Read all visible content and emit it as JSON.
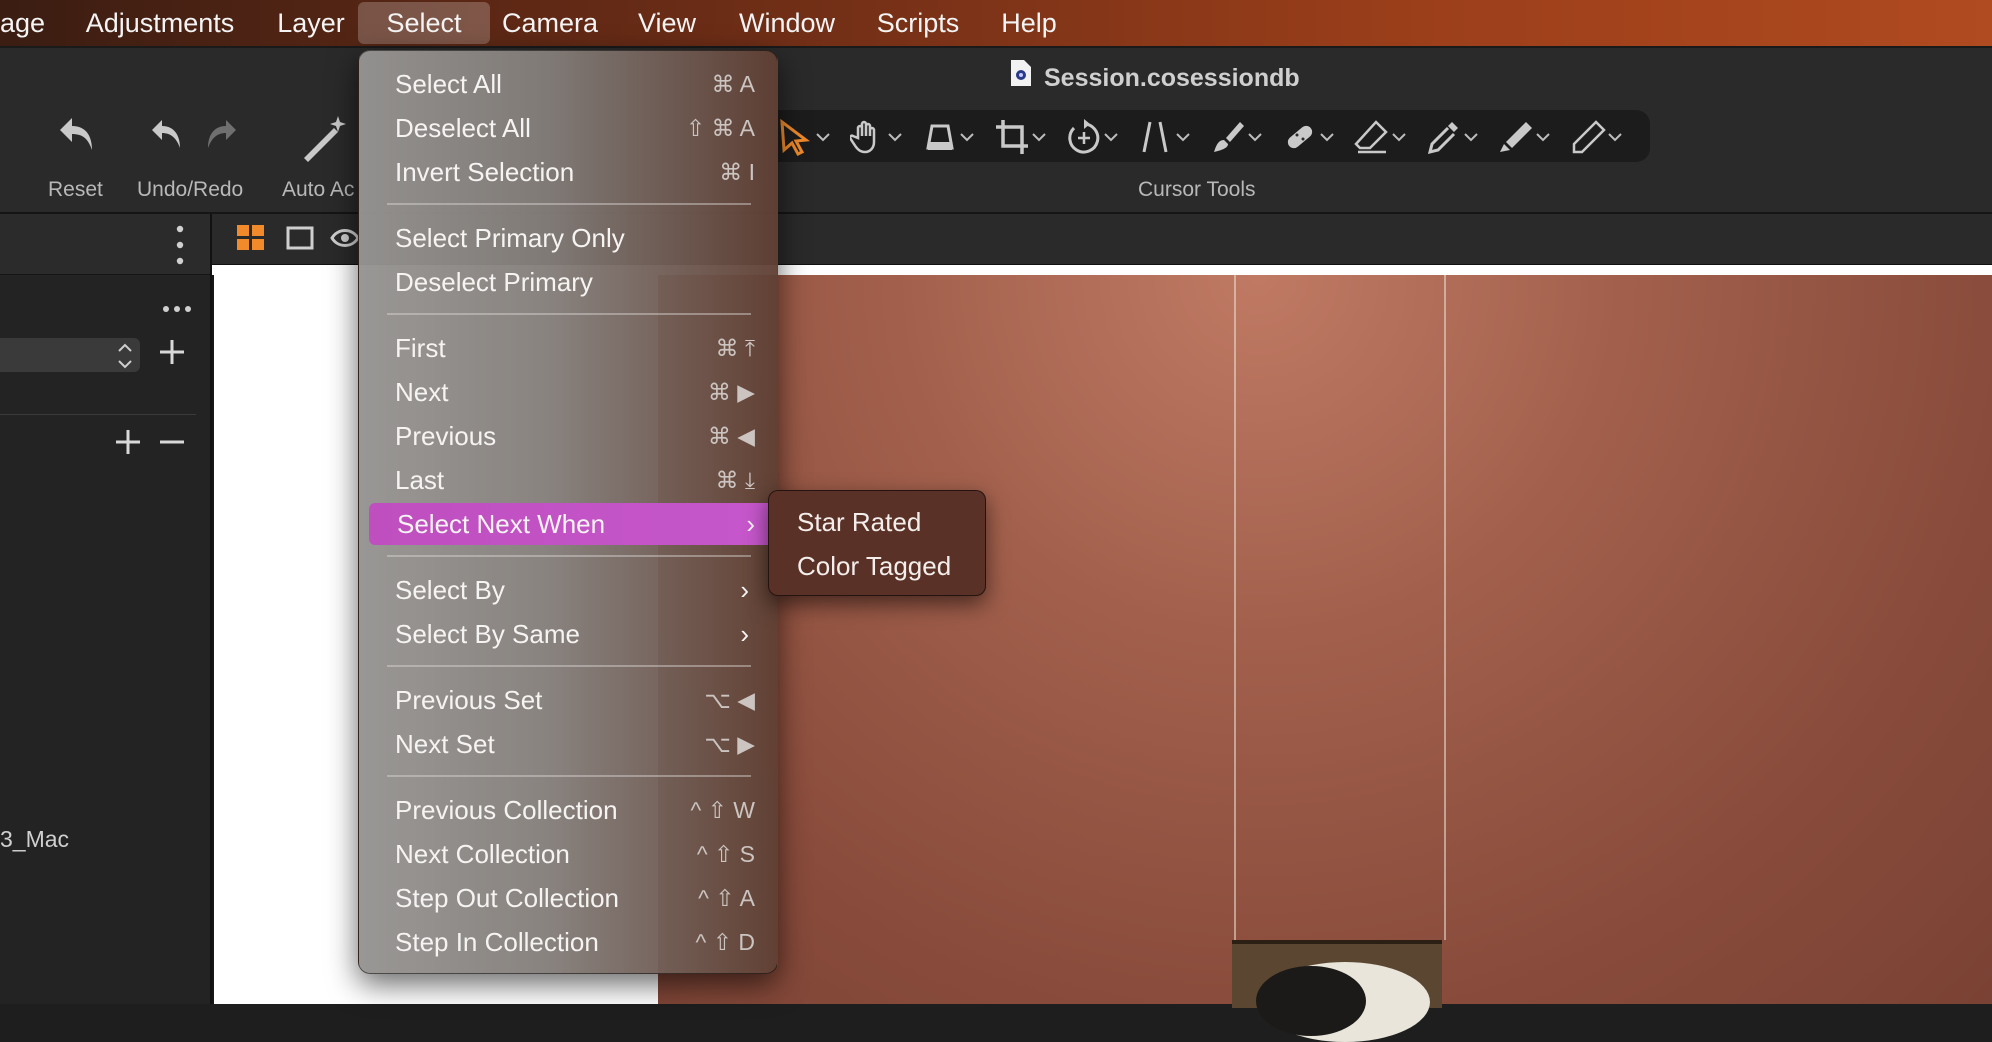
{
  "menubar": {
    "items": [
      {
        "label": "age"
      },
      {
        "label": "Adjustments"
      },
      {
        "label": "Layer"
      },
      {
        "label": "Select"
      },
      {
        "label": "Camera"
      },
      {
        "label": "View"
      },
      {
        "label": "Window"
      },
      {
        "label": "Scripts"
      },
      {
        "label": "Help"
      }
    ],
    "active": "Select"
  },
  "window": {
    "title": "Session.cosessiondb"
  },
  "toolbar": {
    "reset_label": "Reset",
    "undo_redo_label": "Undo/Redo",
    "auto_adjust_label": "Auto Ac",
    "cursor_tools_label": "Cursor Tools",
    "accent_color": "#f08a2a"
  },
  "left_panel": {
    "more_icon": "ellipsis-icon",
    "library_item": "3_Mac"
  },
  "select_menu": {
    "items": [
      {
        "label": "Select All",
        "shortcut": "⌘ A"
      },
      {
        "label": "Deselect All",
        "shortcut": "⇧ ⌘ A"
      },
      {
        "label": "Invert Selection",
        "shortcut": "⌘ I"
      },
      {
        "label": "Select Primary Only",
        "shortcut": ""
      },
      {
        "label": "Deselect Primary",
        "shortcut": ""
      },
      {
        "label": "First",
        "shortcut": "⌘ ⤒"
      },
      {
        "label": "Next",
        "shortcut": "⌘ ▶"
      },
      {
        "label": "Previous",
        "shortcut": "⌘ ◀"
      },
      {
        "label": "Last",
        "shortcut": "⌘ ⤓"
      },
      {
        "label": "Select Next When",
        "shortcut": ""
      },
      {
        "label": "Select By",
        "shortcut": ""
      },
      {
        "label": "Select By Same",
        "shortcut": ""
      },
      {
        "label": "Previous Set",
        "shortcut": "⌥ ◀"
      },
      {
        "label": "Next Set",
        "shortcut": "⌥ ▶"
      },
      {
        "label": "Previous Collection",
        "shortcut": "^ ⇧ W"
      },
      {
        "label": "Next Collection",
        "shortcut": "^ ⇧ S"
      },
      {
        "label": "Step Out Collection",
        "shortcut": "^ ⇧ A"
      },
      {
        "label": "Step In Collection",
        "shortcut": "^ ⇧ D"
      }
    ],
    "highlighted": "Select Next When",
    "highlight_color": "#c252c4"
  },
  "submenu": {
    "items": [
      {
        "label": "Star Rated"
      },
      {
        "label": "Color Tagged"
      }
    ]
  }
}
